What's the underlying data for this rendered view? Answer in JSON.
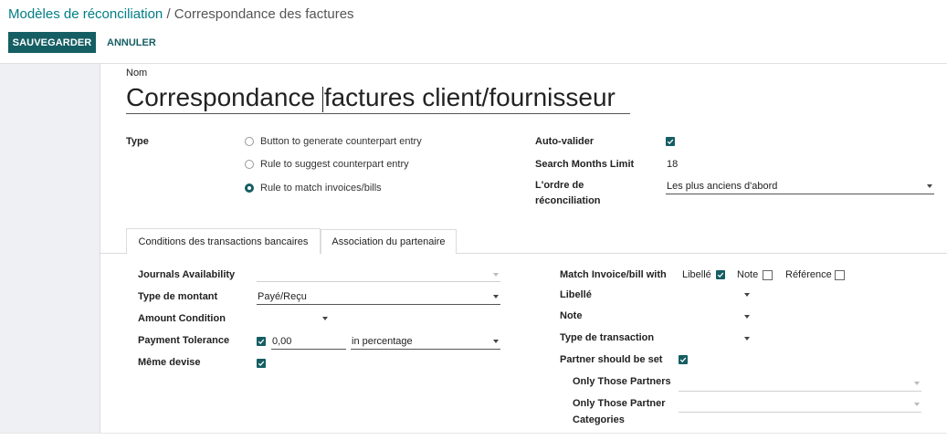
{
  "breadcrumb": {
    "parent": "Modèles de réconciliation",
    "separator": "/",
    "current": "Correspondance des factures"
  },
  "toolbar": {
    "save_label": "SAUVEGARDER",
    "cancel_label": "ANNULER"
  },
  "form": {
    "name_label": "Nom",
    "name_before_caret": "Correspondance ",
    "name_after_caret": "factures client/fournisseur",
    "type_label": "Type",
    "type_options": [
      {
        "label": "Button to generate counterpart entry",
        "selected": false
      },
      {
        "label": "Rule to suggest counterpart entry",
        "selected": false
      },
      {
        "label": "Rule to match invoices/bills",
        "selected": true
      }
    ],
    "auto_validate_label": "Auto-valider",
    "auto_validate_checked": true,
    "search_months_label": "Search Months Limit",
    "search_months_value": "18",
    "order_label_line1": "L'ordre de",
    "order_label_line2": "réconciliation",
    "order_value": "Les plus anciens d'abord"
  },
  "tabs": [
    {
      "label": "Conditions des transactions bancaires",
      "active": true
    },
    {
      "label": "Association du partenaire",
      "active": false
    }
  ],
  "conditions": {
    "journals_label": "Journals Availability",
    "journals_value": "",
    "amount_type_label": "Type de montant",
    "amount_type_value": "Payé/Reçu",
    "amount_condition_label": "Amount Condition",
    "amount_condition_value": "",
    "tolerance_label": "Payment Tolerance",
    "tolerance_checked": true,
    "tolerance_value": "0,00",
    "tolerance_unit": "in percentage",
    "same_currency_label": "Même devise",
    "same_currency_checked": true,
    "match_label": "Match Invoice/bill with",
    "match_libelle": "Libellé",
    "match_libelle_checked": true,
    "match_note": "Note",
    "match_note_checked": false,
    "match_reference": "Référence",
    "match_reference_checked": false,
    "libelle_label": "Libellé",
    "libelle_value": "",
    "note_label": "Note",
    "note_value": "",
    "txn_type_label": "Type de transaction",
    "txn_type_value": "",
    "partner_set_label": "Partner should be set",
    "partner_set_checked": true,
    "only_partners_label": "Only Those Partners",
    "only_partners_value": "",
    "only_categories_label_line1": "Only Those Partner",
    "only_categories_label_line2": "Categories",
    "only_categories_value": ""
  },
  "colors": {
    "accent": "#155e63",
    "link": "#017e84",
    "gutter": "#eef0f3"
  },
  "icons": {
    "check": "checkmark-icon",
    "dropdown": "caret-down-icon"
  }
}
